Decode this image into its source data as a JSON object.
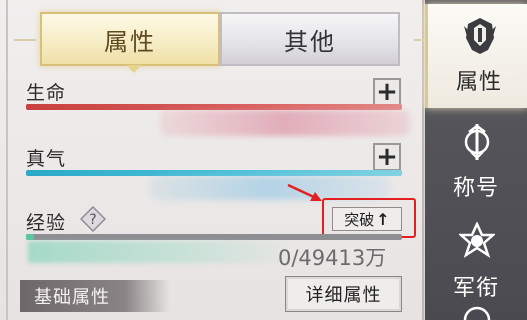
{
  "tabs": [
    {
      "label": "属性",
      "active": true
    },
    {
      "label": "其他",
      "active": false
    }
  ],
  "stats": {
    "life": {
      "label": "生命",
      "plus": "+",
      "color": "#c8403f"
    },
    "qi": {
      "label": "真气",
      "plus": "+",
      "color": "#2aa9c8"
    }
  },
  "experience": {
    "label": "经验",
    "help": "?",
    "break_label": "突破",
    "break_arrow": "↑",
    "current": 0,
    "max_text": "49413万",
    "value_text": "0/49413万",
    "progress": 0.02
  },
  "basic": {
    "header": "基础属性",
    "detail_button": "详细属性"
  },
  "sidenav": [
    {
      "label": "属性",
      "icon": "helmet-icon",
      "active": true
    },
    {
      "label": "称号",
      "icon": "sword-emblem-icon",
      "active": false
    },
    {
      "label": "军衔",
      "icon": "star-emblem-icon",
      "active": false
    }
  ],
  "colors": {
    "highlight_red": "#e32020",
    "exp_fill": "#59c8a0",
    "tab_gold": "#d9c07a"
  }
}
